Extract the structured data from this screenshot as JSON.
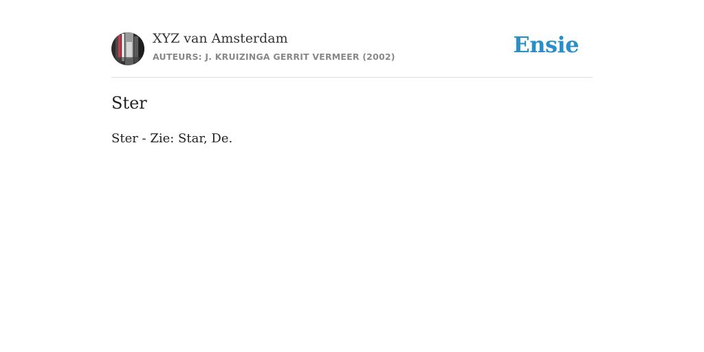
{
  "header": {
    "book_title": "XYZ van Amsterdam",
    "authors_line": "AUTEURS: J. KRUIZINGA GERRIT VERMEER (2002)",
    "logo_text": "Ensie",
    "avatar_icon": "book-cover-photo-icon"
  },
  "entry": {
    "title": "Ster",
    "body": "Ster - Zie: Star, De."
  },
  "colors": {
    "brand": "#2a8fc9",
    "text": "#222222",
    "muted": "#888888",
    "divider": "#dddddd"
  }
}
